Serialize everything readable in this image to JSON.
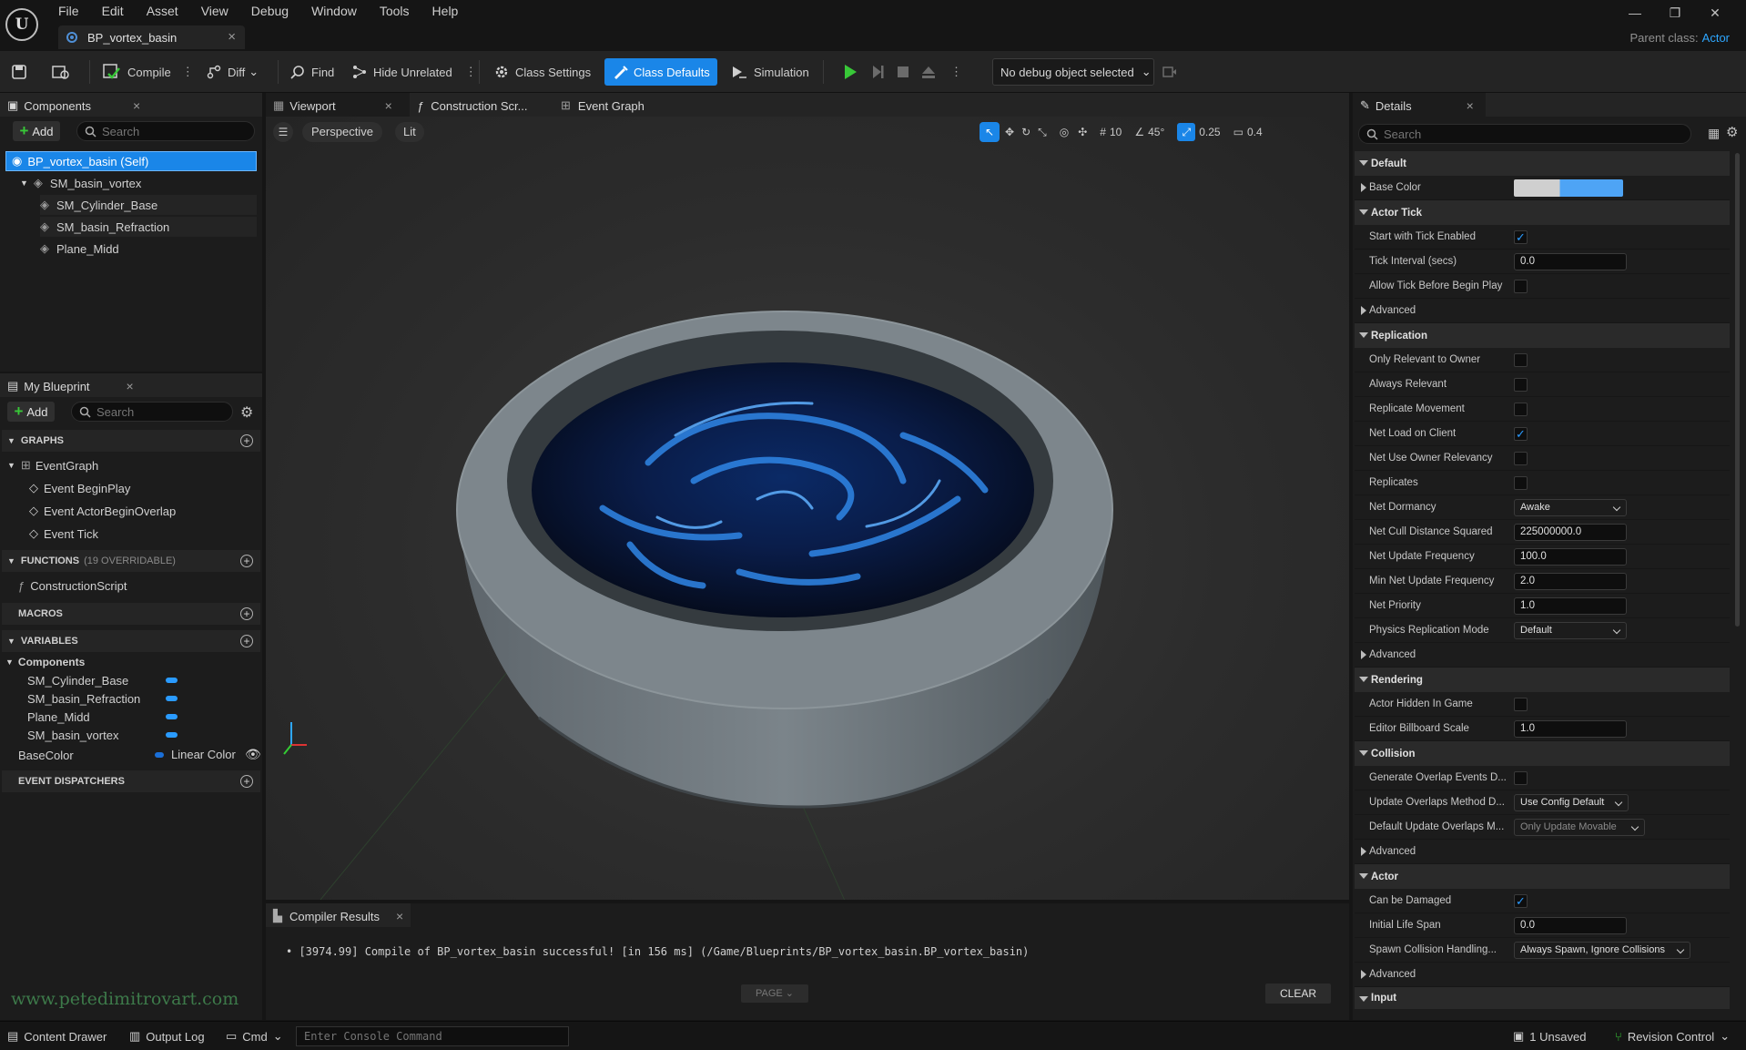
{
  "menu": [
    "File",
    "Edit",
    "Asset",
    "View",
    "Debug",
    "Window",
    "Tools",
    "Help"
  ],
  "doc_tab": "BP_vortex_basin",
  "parent_class": {
    "label": "Parent class:",
    "value": "Actor"
  },
  "toolbar": {
    "compile": "Compile",
    "diff": "Diff",
    "find": "Find",
    "hide_unrelated": "Hide Unrelated",
    "class_settings": "Class Settings",
    "class_defaults": "Class Defaults",
    "simulation": "Simulation",
    "debug_object": "No debug object selected"
  },
  "components": {
    "tab": "Components",
    "add": "Add",
    "search_placeholder": "Search",
    "items": [
      "BP_vortex_basin (Self)",
      "SM_basin_vortex",
      "SM_Cylinder_Base",
      "SM_basin_Refraction",
      "Plane_Midd"
    ]
  },
  "myblueprint": {
    "tab": "My Blueprint",
    "add": "Add",
    "search_placeholder": "Search",
    "graphs_label": "GRAPHS",
    "event_graph": "EventGraph",
    "events": [
      "Event BeginPlay",
      "Event ActorBeginOverlap",
      "Event Tick"
    ],
    "functions_label": "FUNCTIONS",
    "functions_count": "(19 OVERRIDABLE)",
    "construction_script": "ConstructionScript",
    "macros_label": "MACROS",
    "variables_label": "VARIABLES",
    "components_group": "Components",
    "variables": [
      "SM_Cylinder_Base",
      "SM_basin_Refraction",
      "Plane_Midd",
      "SM_basin_vortex"
    ],
    "basecolor_name": "BaseColor",
    "basecolor_type": "Linear Color",
    "dispatchers_label": "EVENT DISPATCHERS"
  },
  "viewport": {
    "tabs": [
      "Viewport",
      "Construction Scr...",
      "Event Graph"
    ],
    "perspective": "Perspective",
    "lit": "Lit",
    "grid": "10",
    "angle": "45°",
    "scale": "0.25",
    "camera_speed": "0.4"
  },
  "compiler": {
    "tab": "Compiler Results",
    "message": "[3974.99] Compile of BP_vortex_basin successful! [in 156 ms] (/Game/Blueprints/BP_vortex_basin.BP_vortex_basin)",
    "page": "PAGE",
    "clear": "CLEAR",
    "watermark": "www.petedimitrovart.com"
  },
  "details": {
    "tab": "Details",
    "search_placeholder": "Search",
    "default": "Default",
    "base_color": "Base Color",
    "actor_tick": "Actor Tick",
    "start_tick": "Start with Tick Enabled",
    "tick_interval": "Tick Interval (secs)",
    "tick_interval_val": "0.0",
    "allow_tick": "Allow Tick Before Begin Play",
    "advanced": "Advanced",
    "replication": "Replication",
    "only_relevant": "Only Relevant to Owner",
    "always_relevant": "Always Relevant",
    "replicate_movement": "Replicate Movement",
    "net_load": "Net Load on Client",
    "net_use_owner": "Net Use Owner Relevancy",
    "replicates": "Replicates",
    "net_dormancy": "Net Dormancy",
    "net_dormancy_val": "Awake",
    "net_cull": "Net Cull Distance Squared",
    "net_cull_val": "225000000.0",
    "net_update": "Net Update Frequency",
    "net_update_val": "100.0",
    "min_net_update": "Min Net Update Frequency",
    "min_net_update_val": "2.0",
    "net_priority": "Net Priority",
    "net_priority_val": "1.0",
    "phys_rep": "Physics Replication Mode",
    "phys_rep_val": "Default",
    "rendering": "Rendering",
    "hidden_in_game": "Actor Hidden In Game",
    "billboard": "Editor Billboard Scale",
    "billboard_val": "1.0",
    "collision": "Collision",
    "gen_overlap": "Generate Overlap Events D...",
    "update_overlaps": "Update Overlaps Method D...",
    "update_overlaps_val": "Use Config Default",
    "default_update": "Default Update Overlaps M...",
    "default_update_val": "Only Update Movable",
    "actor": "Actor",
    "can_be_damaged": "Can be Damaged",
    "life_span": "Initial Life Span",
    "life_span_val": "0.0",
    "spawn_collision": "Spawn Collision Handling...",
    "spawn_collision_val": "Always Spawn, Ignore Collisions",
    "input": "Input"
  },
  "statusbar": {
    "content_drawer": "Content Drawer",
    "output_log": "Output Log",
    "cmd": "Cmd",
    "console_placeholder": "Enter Console Command",
    "unsaved": "1 Unsaved",
    "revision": "Revision Control"
  },
  "colors": {
    "accent": "#1a86e8",
    "base_color_swatch": "#4ea4f5",
    "play": "#38c838"
  }
}
